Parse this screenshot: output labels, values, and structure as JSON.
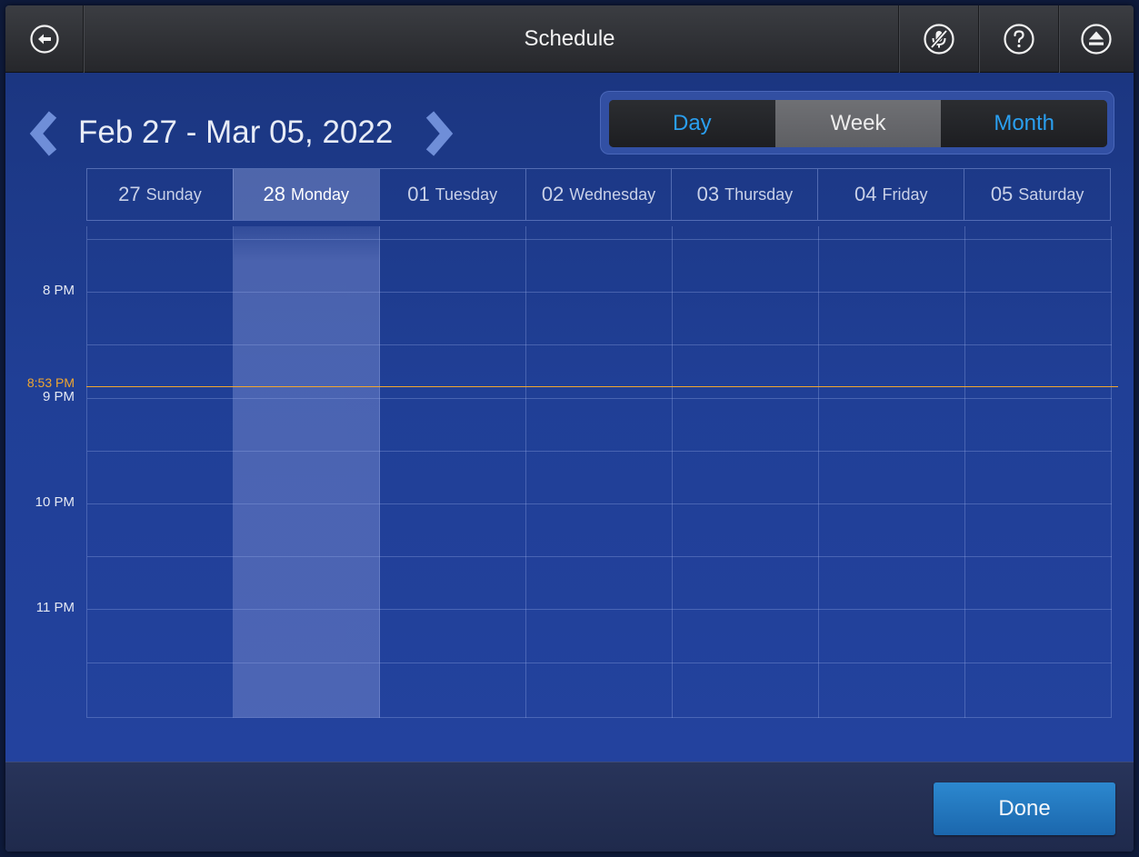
{
  "topbar": {
    "title": "Schedule",
    "back_icon": "back-arrow-icon",
    "mute_icon": "microphone-muted-icon",
    "help_icon": "help-icon",
    "eject_icon": "eject-icon"
  },
  "range": {
    "title": "Feb 27 - Mar 05, 2022",
    "prev_icon": "chevron-left-icon",
    "next_icon": "chevron-right-icon"
  },
  "views": {
    "items": [
      "Day",
      "Week",
      "Month"
    ],
    "selected": "Week"
  },
  "days": [
    {
      "num": "27",
      "name": "Sunday",
      "today": false
    },
    {
      "num": "28",
      "name": "Monday",
      "today": true
    },
    {
      "num": "01",
      "name": "Tuesday",
      "today": false
    },
    {
      "num": "02",
      "name": "Wednesday",
      "today": false
    },
    {
      "num": "03",
      "name": "Thursday",
      "today": false
    },
    {
      "num": "04",
      "name": "Friday",
      "today": false
    },
    {
      "num": "05",
      "name": "Saturday",
      "today": false
    }
  ],
  "time_labels": [
    "8 PM",
    "9 PM",
    "10 PM",
    "11 PM"
  ],
  "now": {
    "label": "8:53 PM"
  },
  "footer": {
    "done_label": "Done"
  },
  "colors": {
    "accent_blue": "#2a9ff0",
    "now_line": "#f0a630",
    "done_button": "#1b67ad"
  }
}
